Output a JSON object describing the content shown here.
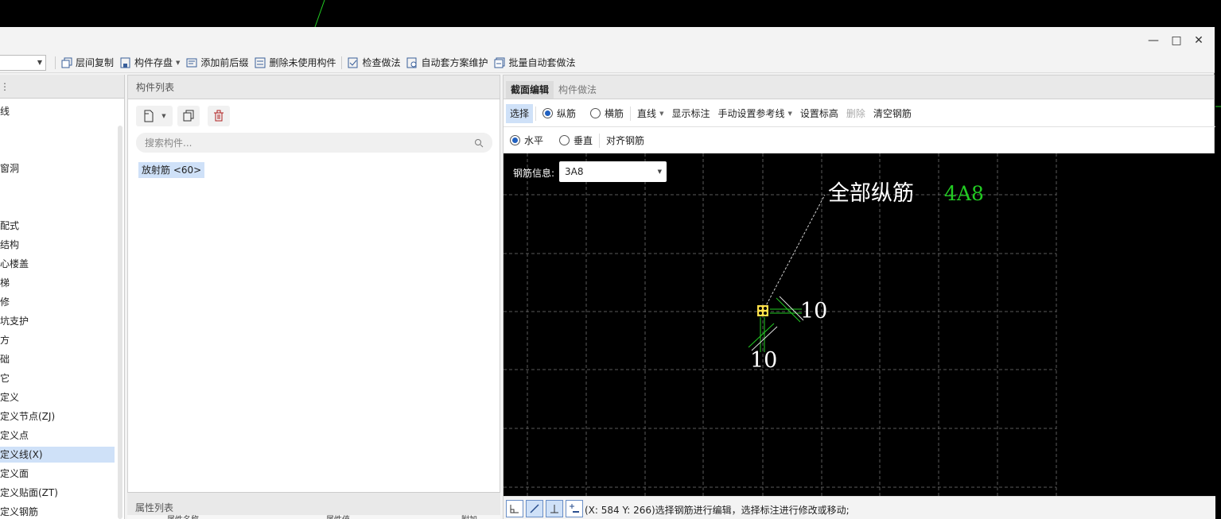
{
  "toolbar": {
    "items": [
      {
        "label": "层间复制",
        "icon": "copy-layers-icon"
      },
      {
        "label": "构件存盘",
        "icon": "save-component-icon"
      },
      {
        "label": "添加前后缀",
        "icon": "add-prefix-icon"
      },
      {
        "label": "删除未使用构件",
        "icon": "delete-unused-icon"
      },
      {
        "label": "检查做法",
        "icon": "check-method-icon"
      },
      {
        "label": "自动套方案维护",
        "icon": "auto-scheme-icon"
      },
      {
        "label": "批量自动套做法",
        "icon": "batch-auto-icon"
      }
    ]
  },
  "left": {
    "items": [
      "线",
      "窗洞",
      "配式",
      "结构",
      "心楼盖",
      "梯",
      "修",
      "坑支护",
      "方",
      "础",
      "它",
      "定义",
      "定义节点(ZJ)",
      "定义点",
      "定义线(X)",
      "定义面",
      "定义贴面(ZT)",
      "定义钢筋"
    ],
    "selected_index": 14
  },
  "mid": {
    "header": "构件列表",
    "search_placeholder": "搜索构件...",
    "component_tag": "放射筋 <60>",
    "prop_header": "属性列表",
    "prop_cols": [
      "属性名称",
      "属性值",
      "附加"
    ]
  },
  "right": {
    "tabs": [
      "截面编辑",
      "构件做法"
    ],
    "bar1": {
      "select": "选择",
      "long_rebar": "纵筋",
      "trans_rebar": "横筋",
      "line": "直线",
      "show_label": "显示标注",
      "manual_ref": "手动设置参考线",
      "set_elev": "设置标高",
      "delete": "删除",
      "clear": "清空钢筋"
    },
    "bar2": {
      "horizontal": "水平",
      "vertical": "垂直",
      "align": "对齐钢筋"
    },
    "rebar_info_label": "钢筋信息:",
    "rebar_value": "3A8",
    "canvas_label_main": "全部纵筋",
    "canvas_label_spec": "4A8",
    "dim_right": "10",
    "dim_bottom": "10",
    "status": "(X: 584 Y: 266)选择钢筋进行编辑，选择标注进行修改或移动;"
  },
  "colors": {
    "canvas_bg": "#000000",
    "grid": "#5a5a5a",
    "rebar_green": "#22cc22",
    "rebar_yellow": "#ffe14a",
    "selection_blue": "#cfe1f8"
  }
}
